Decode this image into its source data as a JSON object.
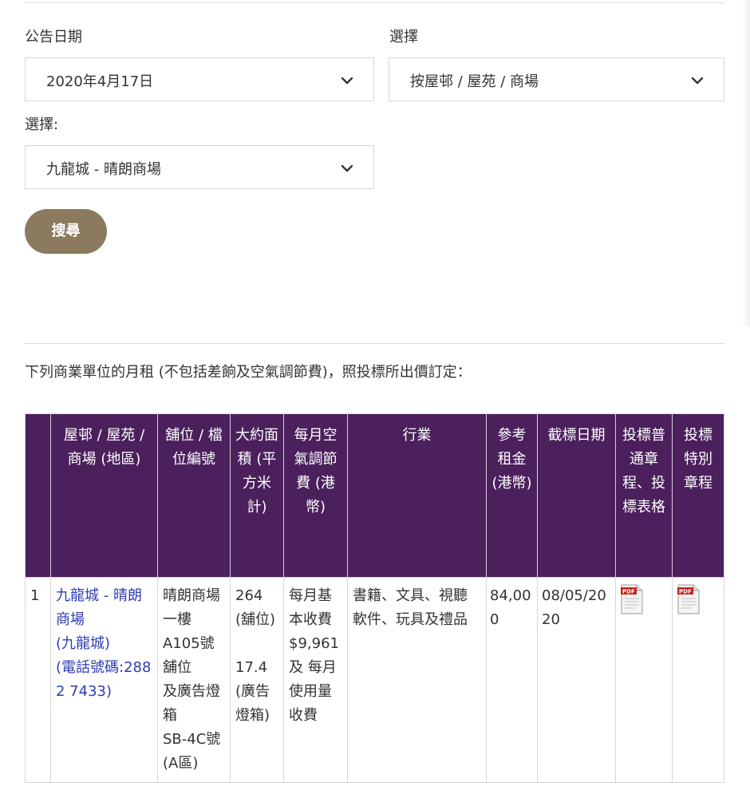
{
  "filters": {
    "date_label": "公告日期",
    "date_value": "2020年4月17日",
    "type_label": "選擇",
    "type_value": "按屋邨 / 屋苑 / 商場",
    "choice_label": "選擇:",
    "choice_value": "九龍城 - 晴朗商場"
  },
  "search_button": "搜尋",
  "notice": "下列商業單位的月租 (不包括差餉及空氣調節費)，照投標所出價訂定：",
  "table": {
    "headers": [
      "",
      "屋邨 / 屋苑 / 商場 (地區)",
      "舖位 / 檔位編號",
      "大約面積 (平方米計)",
      "每月空氣調節費 (港幣)",
      "行業",
      "參考租金 (港幣)",
      "截標日期",
      "投標普通章程、投標表格",
      "投標特別章程"
    ],
    "rows": [
      {
        "index": "1",
        "estate_name": "九龍城 - 晴朗商場",
        "estate_district": "(九龍城)",
        "estate_phone": "(電話號碼:2882 7433)",
        "shop_line1": "晴朗商場一樓",
        "shop_line2": "A105號舖位",
        "shop_line3": "及廣告燈箱",
        "shop_line4": "SB-4C號",
        "shop_line5": "(A區)",
        "area_shop": "264",
        "area_shop_unit": "(舖位)",
        "area_box": "17.4",
        "area_box_unit": "(廣告燈箱)",
        "ac_fee": "每月基本收費 $9,961 及 每月使用量收費",
        "trade": "書籍、文具、視聽軟件、玩具及禮品",
        "reference_rent": "84,000",
        "closing_date": "08/05/2020",
        "general_doc_icon": "pdf-icon",
        "special_doc_icon": "pdf-icon"
      }
    ]
  },
  "colors": {
    "header_bg": "#4b205c",
    "button_bg": "#8b7a5e",
    "link": "#2f3bb3"
  }
}
